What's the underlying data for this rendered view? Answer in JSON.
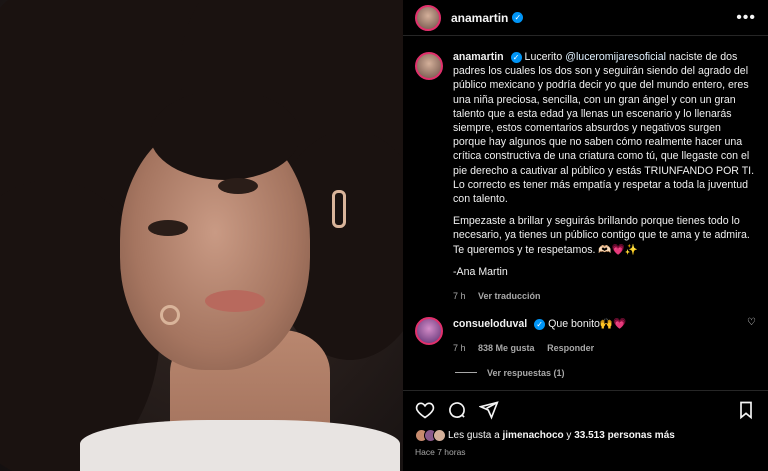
{
  "post": {
    "username": "anamartin",
    "more_label": "•••"
  },
  "caption": {
    "username": "anamartin",
    "text_intro": "Lucerito",
    "mention": "@luceromijaresoficial",
    "text_main": "naciste de dos padres los cuales los dos son y seguirán siendo del agrado del público mexicano y podría decir yo que del mundo entero, eres una niña preciosa, sencilla, con un gran ángel y con un gran talento que a esta edad ya llenas un escenario y lo llenarás siempre, estos comentarios absurdos y negativos surgen porque hay algunos que no saben cómo realmente hacer una crítica constructiva de una criatura como tú, que llegaste con el pie derecho a cautivar al público y estás TRIUNFANDO POR TI. Lo correcto es tener más empatía y respetar a toda la juventud con talento.",
    "para2": "Empezaste a brillar y seguirás brillando porque tienes todo lo necesario, ya tienes un público contigo que te ama y te admira. Te queremos y te respetamos. 🫶🏻💗✨",
    "signature": "-Ana Martin",
    "time": "7 h",
    "translate": "Ver traducción"
  },
  "comment": {
    "username": "consueloduval",
    "text": "Que bonito🙌💗",
    "time": "7 h",
    "likes": "838 Me gusta",
    "reply": "Responder",
    "view_replies": "Ver respuestas (1)"
  },
  "footer": {
    "likes_prefix": "Les gusta a",
    "likes_user": "jimenachoco",
    "likes_mid": "y",
    "likes_count": "33.513 personas más",
    "posted": "Hace 7 horas"
  },
  "colors": {
    "verified": "#0095f6",
    "background": "#000000",
    "muted": "#a8a8a8"
  }
}
